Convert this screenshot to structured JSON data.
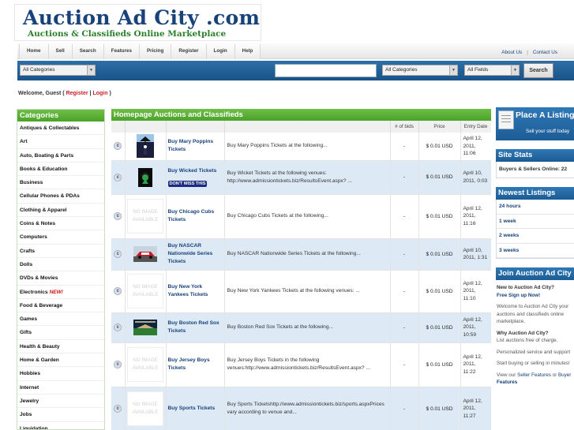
{
  "logo": {
    "title": "Auction Ad City .com",
    "subtitle": "Auctions & Classifieds Online Marketplace"
  },
  "nav": {
    "tabs": [
      "Home",
      "Sell",
      "Search",
      "Features",
      "Pricing",
      "Register",
      "Login",
      "Help"
    ],
    "about": "About Us",
    "separator": "|",
    "contact": "Contact Us"
  },
  "search": {
    "category_left": "All Categories",
    "keyword": "",
    "category_right": "All Categories",
    "fields": "All Fields",
    "button": "Search"
  },
  "welcome": {
    "prefix": "Welcome, Guest (",
    "register": "Register",
    "sep": "|",
    "login": "Login",
    "suffix": ")"
  },
  "categories": {
    "title": "Categories",
    "items": [
      {
        "label": "Antiques & Collectables"
      },
      {
        "label": "Art"
      },
      {
        "label": "Auto, Boating & Parts"
      },
      {
        "label": "Books & Education"
      },
      {
        "label": "Business"
      },
      {
        "label": "Cellular Phones & PDAs"
      },
      {
        "label": "Clothing & Apparel"
      },
      {
        "label": "Coins & Notes"
      },
      {
        "label": "Computers"
      },
      {
        "label": "Crafts"
      },
      {
        "label": "Dolls"
      },
      {
        "label": "DVDs & Movies"
      },
      {
        "label": "Electronics",
        "badge": "NEW!"
      },
      {
        "label": "Food & Beverage"
      },
      {
        "label": "Games"
      },
      {
        "label": "Gifts"
      },
      {
        "label": "Health & Beauty"
      },
      {
        "label": "Home & Garden"
      },
      {
        "label": "Hobbies"
      },
      {
        "label": "Internet"
      },
      {
        "label": "Jewelry"
      },
      {
        "label": "Jobs"
      },
      {
        "label": "Liquidation"
      }
    ]
  },
  "listings": {
    "title": "Homepage Auctions and Classifieds",
    "headers": [
      "",
      "",
      "",
      "",
      "# of bids",
      "Price",
      "Entry Date"
    ],
    "icon_letter": "c",
    "no_image": "NO IMAGE AVAILABLE",
    "rows": [
      {
        "image": "mary-poppins",
        "title": "Buy Mary Poppins Tickets",
        "desc": "Buy Mary Poppins Tickets at the following...",
        "bids": "-",
        "price": "$ 0.01 USD",
        "date": "April 12, 2011, 11:06"
      },
      {
        "image": "wicked",
        "title": "Buy Wicked Tickets",
        "badge": "DON'T MISS THIS",
        "desc": "Buy Wicket Tickets at the following venues: http://www.admissiontickets.biz/ResultsEvent.aspx? ...",
        "bids": "-",
        "price": "$ 0.01 USD",
        "date": "April 10, 2011, 0:03"
      },
      {
        "image": "none",
        "title": "Buy Chicago Cubs Tickets",
        "desc": "Buy Chicago Cubs Tickets at the following...",
        "bids": "-",
        "price": "$ 0.01 USD",
        "date": "April 12, 2011, 11:16"
      },
      {
        "image": "nascar",
        "title": "Buy NASCAR Nationwide Series Tickets",
        "desc": "Buy NASCAR Nationwide Series Tickets at the following...",
        "bids": "-",
        "price": "$ 0.01 USD",
        "date": "April 10, 2011, 1:31"
      },
      {
        "image": "none",
        "title": "Buy New York Yankees Tickets",
        "desc": "Buy New York Yankees Tickets at the following venues: ...",
        "bids": "-",
        "price": "$ 0.01 USD",
        "date": "April 12, 2011, 11:10"
      },
      {
        "image": "stadium",
        "title": "Buy Boston Red Sox Tickets",
        "desc": "Buy Boston Red Sox Tickets at the following...",
        "bids": "-",
        "price": "$ 0.01 USD",
        "date": "April 12, 2011, 10:59"
      },
      {
        "image": "none",
        "title": "Buy Jersey Boys Tickets",
        "desc": "Buy Jersey Boys Tickets in the following venues:http://www.admissiontickets.biz/ResultsEvent.aspx? ...",
        "bids": "-",
        "price": "$ 0.01 USD",
        "date": "April 12, 2011, 11:22"
      },
      {
        "image": "none",
        "title": "Buy Sports Tickets",
        "desc": "Buy Sports Ticketshttp://www.admissiontickets.biz/sports.aspxPrices vary according to venue and...",
        "bids": "-",
        "price": "$ 0.01 USD",
        "date": "April 12, 2011, 11:27"
      }
    ]
  },
  "right": {
    "place": {
      "title": "Place A Listing",
      "subtitle": "Sell your stuff today"
    },
    "stats": {
      "title": "Site Stats",
      "line": "Buyers & Sellers Online: 22"
    },
    "newest": {
      "title": "Newest Listings",
      "items": [
        "24 hours",
        "1 week",
        "2 weeks",
        "3 weeks"
      ]
    },
    "join": {
      "title": "Join Auction Ad City",
      "new_q": "New to Auction Ad City?",
      "signup": "Free Sign up Now!",
      "welcome1": "Welcome to Auction Ad City your",
      "welcome2": "auctions and classifieds online",
      "welcome3": "marketplace.",
      "why": "Why Auction Ad City?",
      "free": "List auctions free of charge.",
      "personal": "Personalized service and support",
      "start": "Start buying or selling in minutes!",
      "view_prefix": "View our",
      "seller_features": "Seller Features",
      "or": "or",
      "buyer": "Buyer",
      "features": "Features"
    }
  }
}
